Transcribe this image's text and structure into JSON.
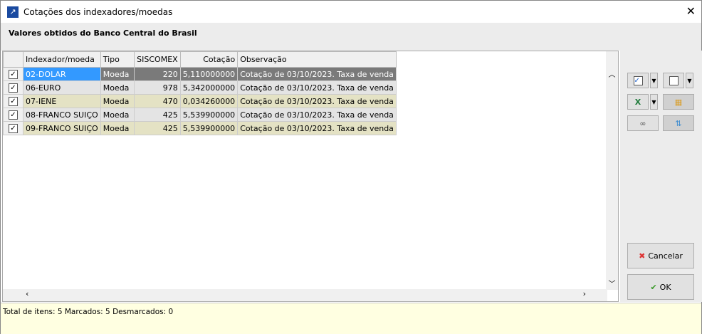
{
  "window": {
    "title": "Cotações dos indexadores/moedas",
    "close": "✕"
  },
  "header": "Valores obtidos do Banco Central do Brasil",
  "grid": {
    "columns": [
      "Indexador/moeda",
      "Tipo",
      "SISCOMEX",
      "Cotação",
      "Observação"
    ],
    "rows": [
      {
        "checked": true,
        "indexador": "02-DOLAR",
        "tipo": "Moeda",
        "siscomex": "220",
        "cotacao": "5,110000000",
        "obs": "Cotação de 03/10/2023. Taxa de venda"
      },
      {
        "checked": true,
        "indexador": "06-EURO",
        "tipo": "Moeda",
        "siscomex": "978",
        "cotacao": "5,342000000",
        "obs": "Cotação de 03/10/2023. Taxa de venda"
      },
      {
        "checked": true,
        "indexador": "07-IENE",
        "tipo": "Moeda",
        "siscomex": "470",
        "cotacao": "0,034260000",
        "obs": "Cotação de 03/10/2023. Taxa de venda"
      },
      {
        "checked": true,
        "indexador": "08-FRANCO SUIÇO",
        "tipo": "Moeda",
        "siscomex": "425",
        "cotacao": "5,539900000",
        "obs": "Cotação de 03/10/2023. Taxa de venda"
      },
      {
        "checked": true,
        "indexador": "09-FRANCO SUIÇO",
        "tipo": "Moeda",
        "siscomex": "425",
        "cotacao": "5,539900000",
        "obs": "Cotação de 03/10/2023. Taxa de venda"
      }
    ]
  },
  "buttons": {
    "cancel": "Cancelar",
    "ok": "OK"
  },
  "status": "Total de itens: 5 Marcados: 5 Desmarcados: 0"
}
